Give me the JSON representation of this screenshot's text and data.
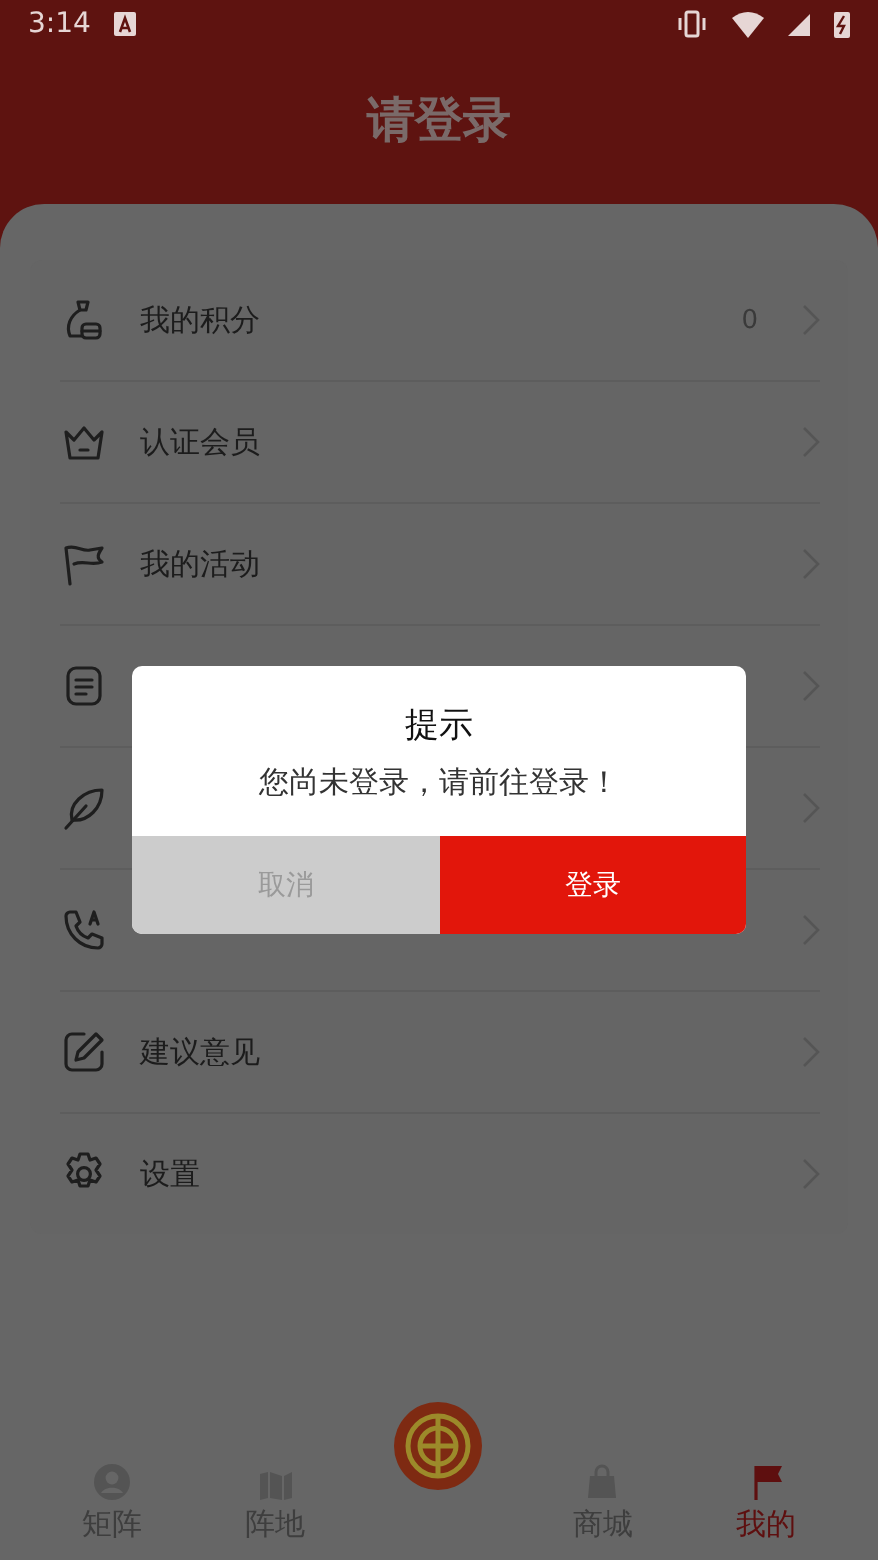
{
  "status_bar": {
    "time": "3:14"
  },
  "header": {
    "title": "请登录"
  },
  "menu": [
    {
      "kind": "row",
      "label": "我的积分",
      "value": "0"
    },
    {
      "kind": "row",
      "label": "认证会员"
    },
    {
      "kind": "row",
      "label": "我的活动"
    },
    {
      "kind": "covered"
    },
    {
      "kind": "covered"
    },
    {
      "kind": "covered"
    },
    {
      "kind": "row",
      "label": "建议意见"
    },
    {
      "kind": "row",
      "label": "设置"
    }
  ],
  "dialog": {
    "title": "提示",
    "message": "您尚未登录，请前往登录！",
    "cancel": "取消",
    "confirm": "登录"
  },
  "tabs": [
    {
      "kind": "tab",
      "label": "矩阵",
      "selected": false
    },
    {
      "kind": "tab",
      "label": "阵地",
      "selected": false
    },
    {
      "kind": "logo",
      "selected": false
    },
    {
      "kind": "tab",
      "label": "商城",
      "selected": false
    },
    {
      "kind": "tab",
      "label": "我的",
      "selected": true
    }
  ]
}
